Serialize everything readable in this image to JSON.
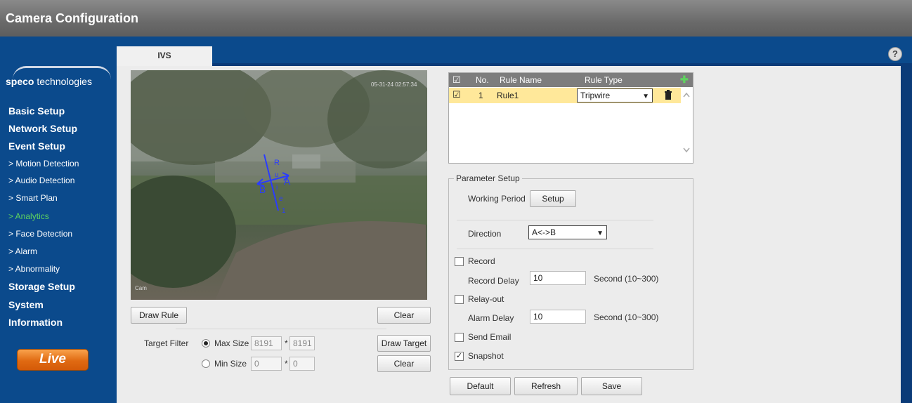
{
  "window": {
    "title": "Camera Configuration"
  },
  "logo": {
    "brand_bold": "speco",
    "brand_rest": " technologies"
  },
  "sidebar": {
    "items": [
      {
        "label": "Basic Setup"
      },
      {
        "label": "Network Setup"
      },
      {
        "label": "Event Setup"
      },
      {
        "label": "> Motion Detection"
      },
      {
        "label": "> Audio Detection"
      },
      {
        "label": "> Smart Plan"
      },
      {
        "label": "> Analytics"
      },
      {
        "label": "> Face Detection"
      },
      {
        "label": "> Alarm"
      },
      {
        "label": "> Abnormality"
      },
      {
        "label": "Storage Setup"
      },
      {
        "label": "System"
      },
      {
        "label": "Information"
      }
    ],
    "live_label": "Live",
    "active_color": "#5fd35f"
  },
  "tabs": [
    {
      "label": "IVS"
    }
  ],
  "help_icon": "?",
  "video": {
    "osd_top": "05-31-24  02:57:34",
    "osd_bottom": "Cam",
    "overlay_labels": {
      "r": "R",
      "u": "u",
      "a": "A",
      "b": "B",
      "i": "i",
      "e": "e",
      "one": "1"
    }
  },
  "buttons": {
    "draw_rule": "Draw Rule",
    "clear_top": "Clear",
    "draw_target": "Draw Target",
    "clear_bottom": "Clear",
    "setup": "Setup",
    "default": "Default",
    "refresh": "Refresh",
    "save": "Save"
  },
  "target_filter": {
    "label": "Target Filter",
    "max_label": "Max Size",
    "max_w": "8191",
    "max_h": "8191",
    "min_label": "Min Size",
    "min_w": "0",
    "min_h": "0",
    "times": "*"
  },
  "rule_table": {
    "headers": {
      "check": "☑",
      "no": "No.",
      "name": "Rule Name",
      "type": "Rule Type"
    },
    "add_icon": "✚",
    "rows": [
      {
        "check": "☑",
        "no": "1",
        "name": "Rule1",
        "type": "Tripwire"
      }
    ]
  },
  "params": {
    "legend": "Parameter Setup",
    "working_period": "Working Period",
    "direction_label": "Direction",
    "direction_value": "A<->B",
    "record": "Record",
    "record_delay": "Record Delay",
    "record_delay_value": "10",
    "record_range": "Second (10~300)",
    "relay_out": "Relay-out",
    "alarm_delay": "Alarm Delay",
    "alarm_delay_value": "10",
    "alarm_range": "Second (10~300)",
    "send_email": "Send Email",
    "snapshot": "Snapshot",
    "snapshot_checked": "✓"
  }
}
